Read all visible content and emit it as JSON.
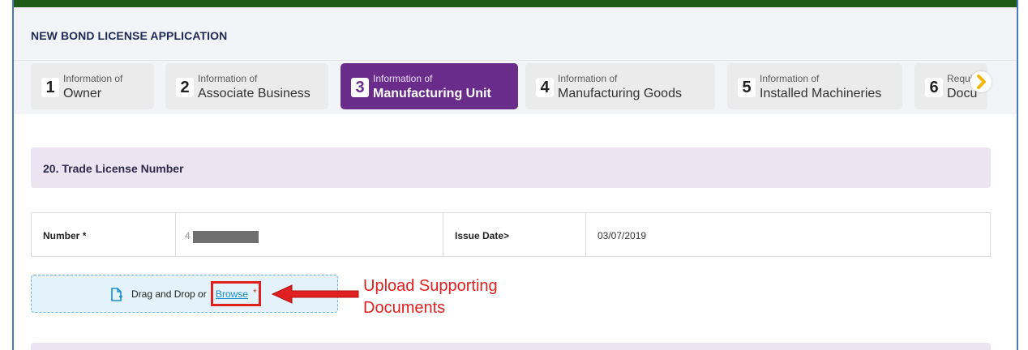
{
  "header": {
    "title": "NEW BOND LICENSE APPLICATION"
  },
  "steps": [
    {
      "number": "1",
      "caption": "Information of",
      "label": "Owner"
    },
    {
      "number": "2",
      "caption": "Information of",
      "label": "Associate Business"
    },
    {
      "number": "3",
      "caption": "Information of",
      "label": "Manufacturing Unit",
      "active": true
    },
    {
      "number": "4",
      "caption": "Information of",
      "label": "Manufacturing Goods"
    },
    {
      "number": "5",
      "caption": "Information of",
      "label": "Installed Machineries"
    },
    {
      "number": "6",
      "caption": "Requir",
      "label": "Docu"
    }
  ],
  "section": {
    "title": "20. Trade License Number"
  },
  "table": {
    "number_label": "Number",
    "required_mark": "*",
    "number_value": "4",
    "issue_date_label": "Issue Date>",
    "issue_date_value": "03/07/2019"
  },
  "upload": {
    "text": "Drag and Drop or",
    "browse_label": "Browse",
    "required_mark": "*"
  },
  "annotation": {
    "line1": "Upload Supporting",
    "line2": "Documents"
  },
  "colors": {
    "topbar": "#1f5a17",
    "active_step": "#6a2c8b",
    "section_bg": "#ece5f1",
    "dropzone_bg": "#e4f3fb",
    "annotation": "#e02020",
    "link": "#1a8fd0"
  },
  "icons": {
    "next": "chevron-right-icon",
    "upload": "file-upload-icon",
    "callout": "arrow-left-icon"
  }
}
